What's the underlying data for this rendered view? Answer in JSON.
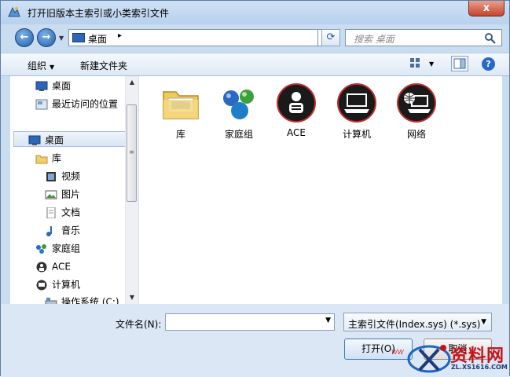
{
  "window": {
    "title": "打开旧版本主索引或小类索引文件",
    "close_label": "x"
  },
  "nav": {
    "address_location": "桌面",
    "address_separator": "▸",
    "search_placeholder": "搜索 桌面"
  },
  "toolbar": {
    "organize_label": "组织",
    "new_folder_label": "新建文件夹"
  },
  "sidebar": {
    "items": [
      {
        "label": "桌面",
        "icon": "desktop-icon"
      },
      {
        "label": "最近访问的位置",
        "icon": "recent-places-icon"
      },
      {
        "label": "桌面",
        "icon": "desktop-icon"
      },
      {
        "label": "库",
        "icon": "library-icon"
      },
      {
        "label": "视频",
        "icon": "video-icon"
      },
      {
        "label": "图片",
        "icon": "picture-icon"
      },
      {
        "label": "文档",
        "icon": "document-icon"
      },
      {
        "label": "音乐",
        "icon": "music-icon"
      },
      {
        "label": "家庭组",
        "icon": "homegroup-icon"
      },
      {
        "label": "ACE",
        "icon": "user-icon"
      },
      {
        "label": "计算机",
        "icon": "computer-icon"
      },
      {
        "label": "操作系统 (C:)",
        "icon": "drive-icon"
      }
    ]
  },
  "main": {
    "tiles": [
      {
        "label": "库",
        "icon": "library-folder-icon"
      },
      {
        "label": "家庭组",
        "icon": "homegroup-icon"
      },
      {
        "label": "ACE",
        "icon": "user-icon"
      },
      {
        "label": "计算机",
        "icon": "computer-icon"
      },
      {
        "label": "网络",
        "icon": "network-icon"
      }
    ]
  },
  "bottom": {
    "filename_label": "文件名(N):",
    "filename_value": "",
    "filter_value": "主索引文件(Index.sys) (*.sys)",
    "open_label": "打开(O)",
    "cancel_label": "取消"
  },
  "watermark": {
    "text": "资料网",
    "url": "ZL.XS1616.COM",
    "prefix": "WW"
  },
  "colors": {
    "accent": "#2a69c3",
    "title_bar": "#c9dcf0",
    "close_button": "#c7432b",
    "watermark_red": "#c2161b"
  }
}
